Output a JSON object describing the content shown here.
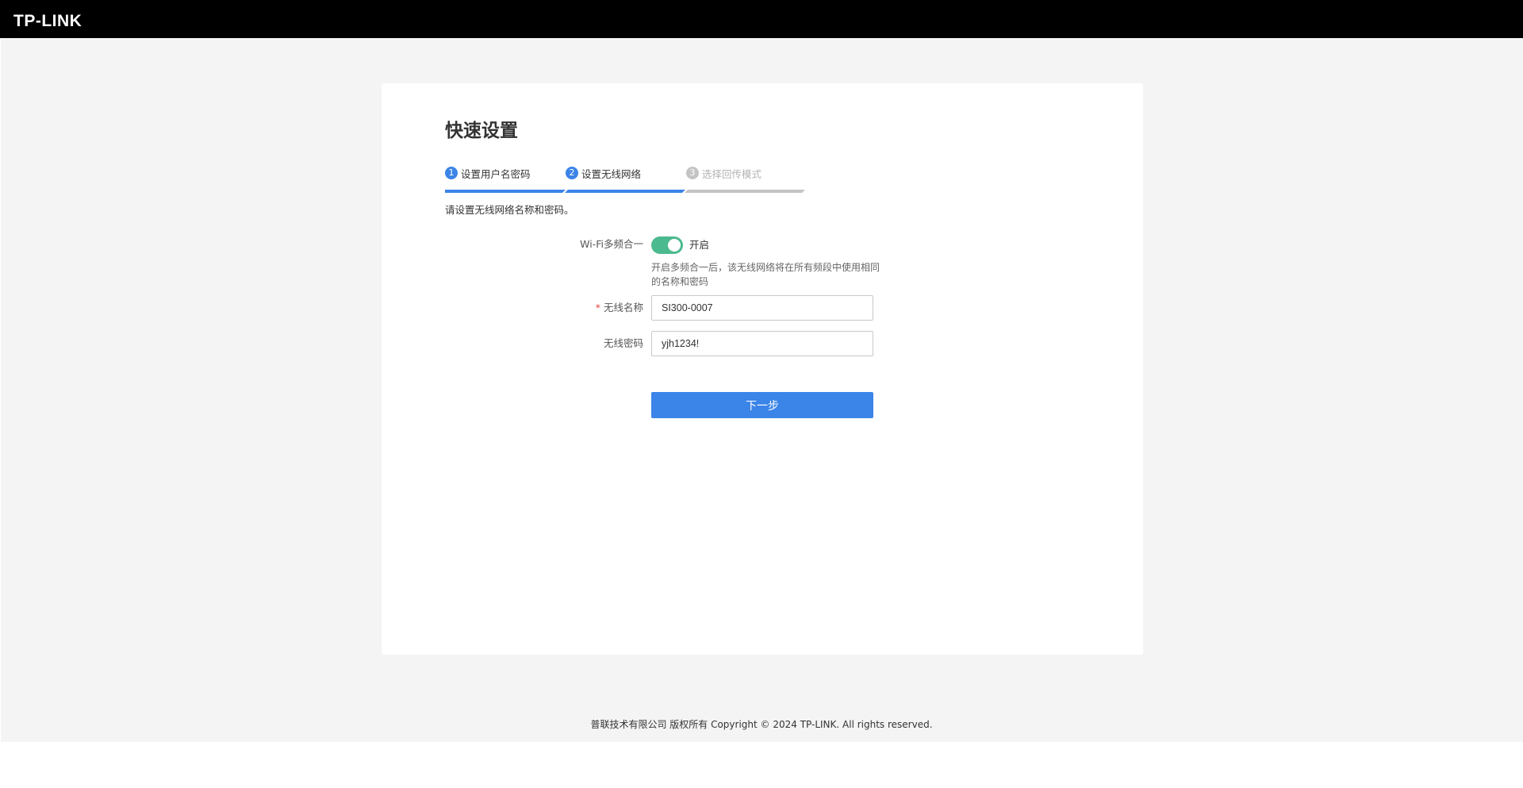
{
  "header": {
    "logo_text": "TP-LINK"
  },
  "wizard": {
    "title": "快速设置",
    "steps": [
      {
        "number": "1",
        "label": "设置用户名密码",
        "state": "done"
      },
      {
        "number": "2",
        "label": "设置无线网络",
        "state": "current"
      },
      {
        "number": "3",
        "label": "选择回传模式",
        "state": "pending"
      }
    ],
    "instruction": "请设置无线网络名称和密码。"
  },
  "form": {
    "band_steering": {
      "label": "Wi-Fi多频合一",
      "enabled": true,
      "state_text": "开启",
      "hint": "开启多频合一后，该无线网络将在所有频段中使用相同的名称和密码"
    },
    "ssid": {
      "required_mark": "*",
      "label": "无线名称",
      "value": "SI300-0007"
    },
    "password": {
      "label": "无线密码",
      "value": "yjh1234!"
    },
    "next_label": "下一步"
  },
  "footer": {
    "copyright": "普联技术有限公司 版权所有 Copyright © 2024 TP-LINK. All rights reserved."
  },
  "colors": {
    "header_bg": "#000000",
    "page_bg": "#f4f4f4",
    "accent": "#3b84e8",
    "toggle_on": "#4cba8f",
    "inactive": "#c4c4c4",
    "required": "#e64340"
  }
}
